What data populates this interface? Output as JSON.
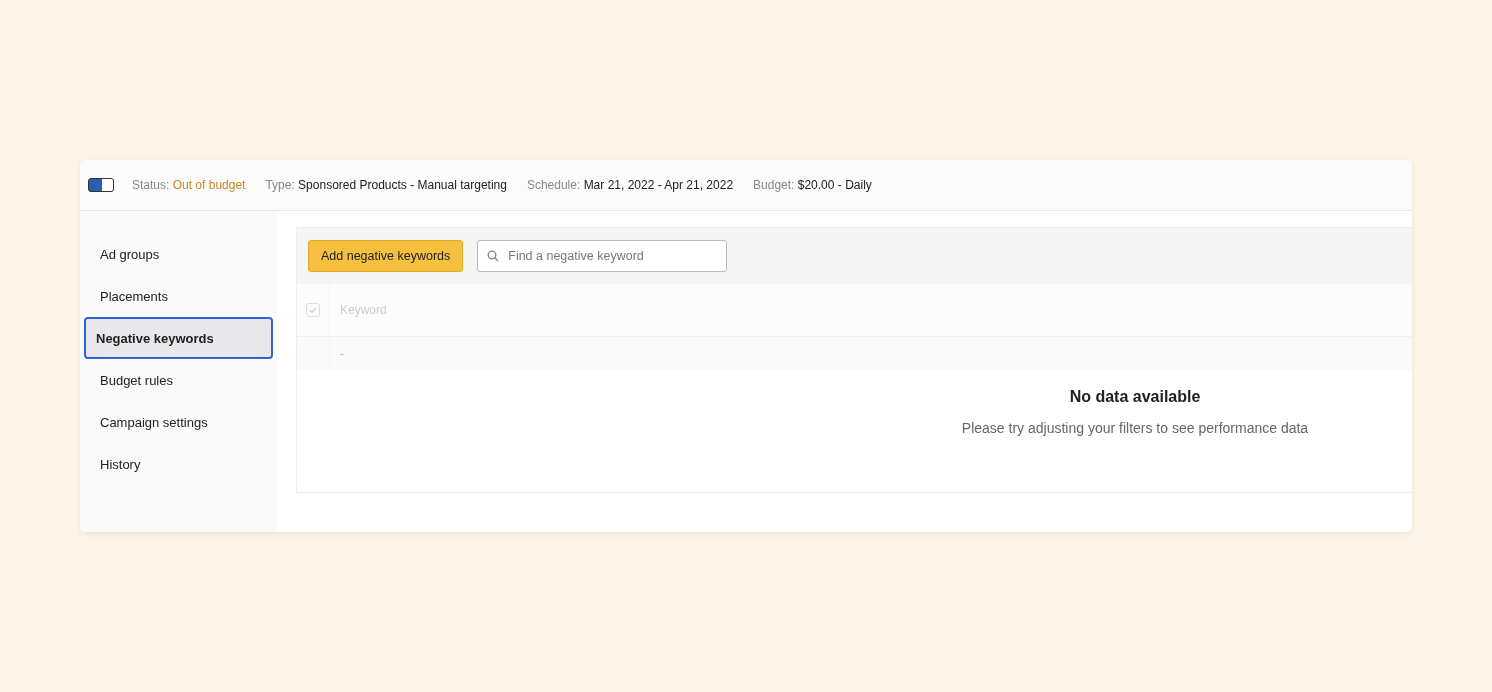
{
  "campaign_header": {
    "toggle": {
      "on": true
    },
    "fields": [
      {
        "label": "Status:",
        "value": "Out of budget",
        "kind": "status"
      },
      {
        "label": "Type:",
        "value": "Sponsored Products - Manual targeting",
        "kind": "plain"
      },
      {
        "label": "Schedule:",
        "value": "Mar 21, 2022 - Apr 21, 2022",
        "kind": "plain"
      },
      {
        "label": "Budget:",
        "value": "$20.00 - Daily",
        "kind": "plain"
      }
    ]
  },
  "sidebar": {
    "items": [
      {
        "label": "Ad groups",
        "selected": false
      },
      {
        "label": "Placements",
        "selected": false
      },
      {
        "label": "Negative keywords",
        "selected": true
      },
      {
        "label": "Budget rules",
        "selected": false
      },
      {
        "label": "Campaign settings",
        "selected": false
      },
      {
        "label": "History",
        "selected": false
      }
    ]
  },
  "toolbar": {
    "add_button": "Add negative keywords",
    "search": {
      "placeholder": "Find a negative keyword"
    }
  },
  "table": {
    "select_all": {
      "checked": true
    },
    "columns": [
      "Keyword"
    ],
    "rows": [
      [
        "-"
      ]
    ]
  },
  "empty_state": {
    "title": "No data available",
    "message": "Please try adjusting your filters to see performance data"
  }
}
